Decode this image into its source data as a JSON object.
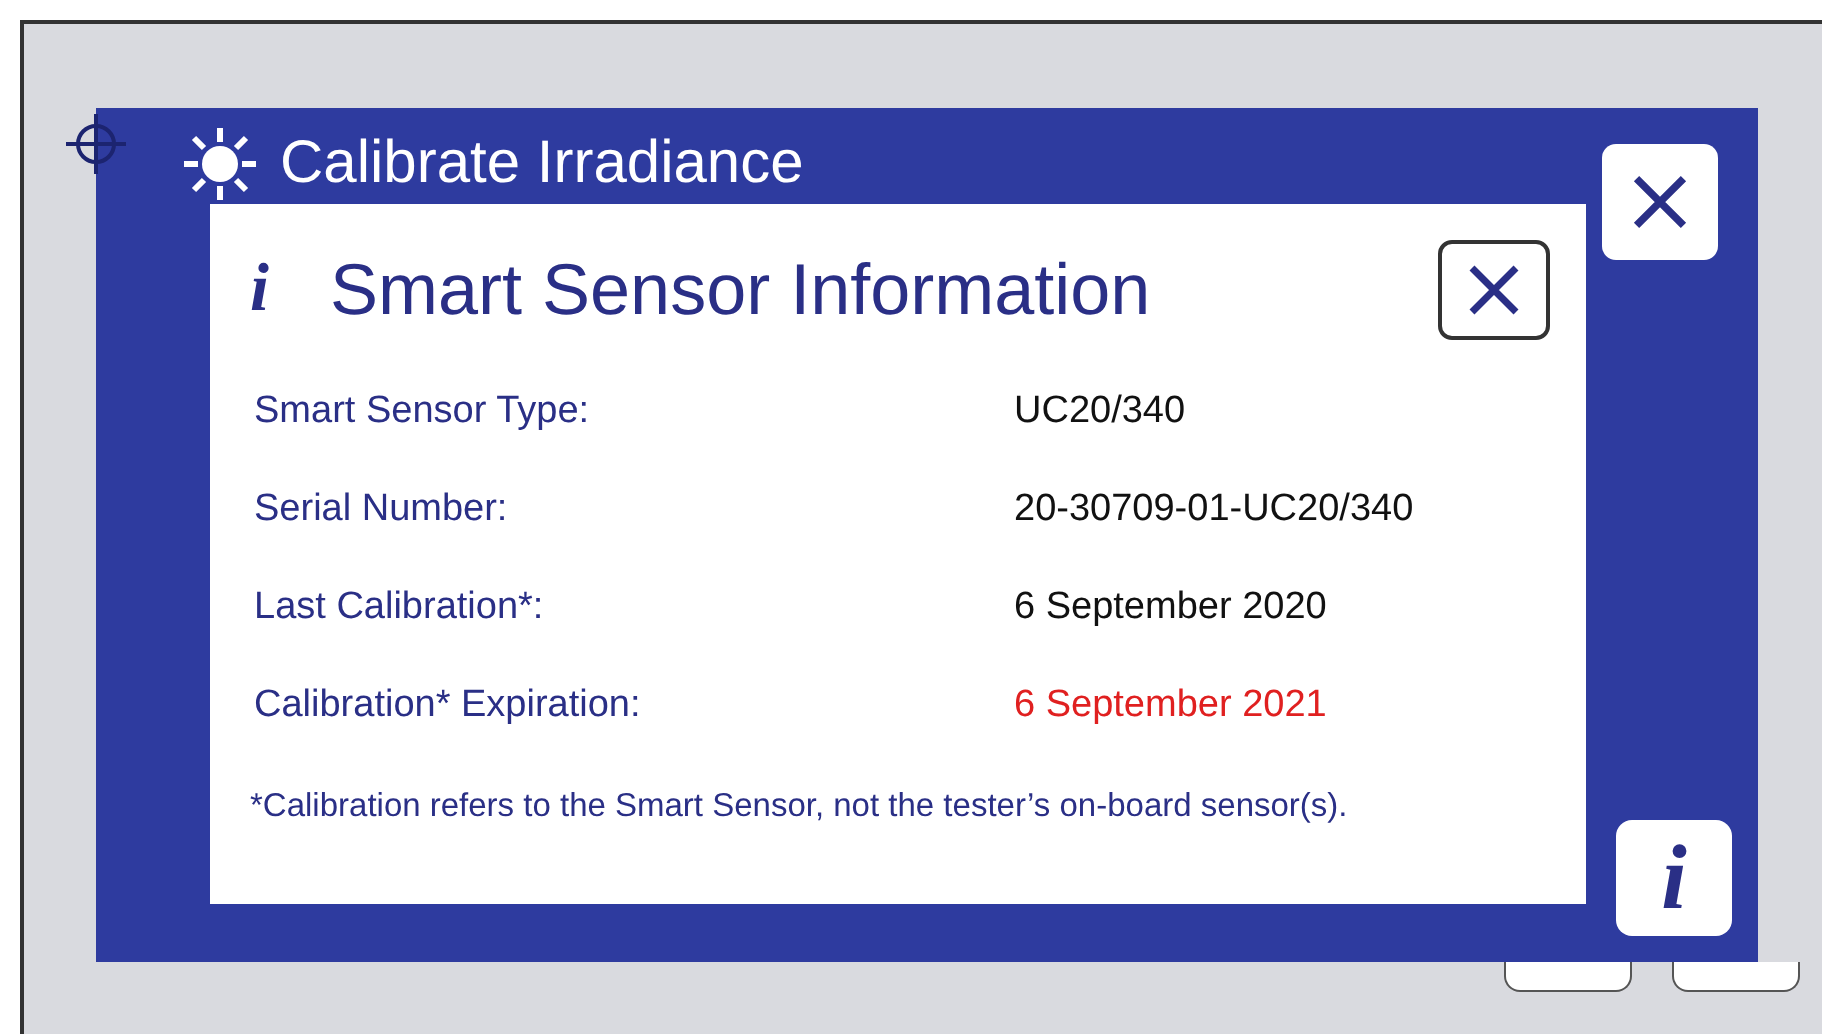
{
  "screen": {
    "title": "Calibrate Irradiance"
  },
  "dialog": {
    "title": "Smart Sensor Information",
    "rows": [
      {
        "label": "Smart Sensor Type:",
        "value": "UC20/340",
        "alert": false
      },
      {
        "label": "Serial Number:",
        "value": "20-30709-01-UC20/340",
        "alert": false
      },
      {
        "label": "Last Calibration*:",
        "value": "6 September 2020",
        "alert": false
      },
      {
        "label": "Calibration* Expiration:",
        "value": "6 September 2021",
        "alert": true
      }
    ],
    "footnote": "*Calibration refers to the Smart Sensor, not the tester’s on-board sensor(s)."
  },
  "info_button": {
    "label": "i"
  },
  "dialog_icon": {
    "label": "i"
  }
}
